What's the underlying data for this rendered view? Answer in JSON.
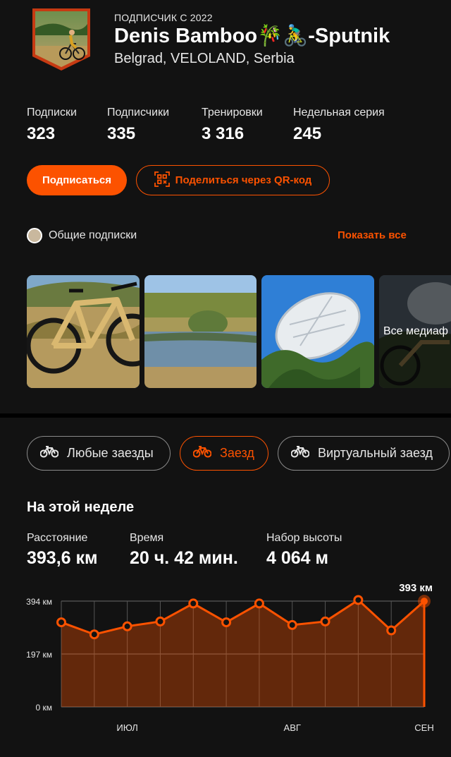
{
  "profile": {
    "since": "ПОДПИСЧИК С 2022",
    "name": "Denis Bamboo🎋🚴‍♂️-Sputnik",
    "location": "Belgrad, VELOLAND, Serbia"
  },
  "stats": [
    {
      "label": "Подписки",
      "value": "323"
    },
    {
      "label": "Подписчики",
      "value": "335"
    },
    {
      "label": "Тренировки",
      "value": "3 316"
    },
    {
      "label": "Недельная серия",
      "value": "245"
    }
  ],
  "actions": {
    "follow": "Подписаться",
    "share_qr": "Поделиться через QR-код"
  },
  "mutual": {
    "label": "Общие подписки",
    "show_all": "Показать все"
  },
  "media": {
    "all_media": "Все медиаф"
  },
  "filters": [
    {
      "label": "Любые заезды",
      "active": false,
      "icon": "bike-icon"
    },
    {
      "label": "Заезд",
      "active": true,
      "icon": "bike-icon"
    },
    {
      "label": "Виртуальный заезд",
      "active": false,
      "icon": "bike-icon"
    }
  ],
  "week": {
    "title": "На этой неделе",
    "metrics": [
      {
        "label": "Расстояние",
        "value": "393,6 км"
      },
      {
        "label": "Время",
        "value": "20 ч. 42 мин."
      },
      {
        "label": "Набор высоты",
        "value": "4 064 м"
      }
    ]
  },
  "colors": {
    "accent": "#fc5200",
    "background": "#121212"
  },
  "chart_data": {
    "type": "area",
    "y_tick_labels": [
      "394 км",
      "197 км",
      "0 км"
    ],
    "y_ticks": [
      394,
      197,
      0
    ],
    "ylim": [
      0,
      394
    ],
    "x_tick_labels": [
      "ИЮЛ",
      "АВГ",
      "СЕН"
    ],
    "x_tick_index": [
      2,
      7,
      11
    ],
    "values": [
      315,
      270,
      300,
      318,
      385,
      315,
      385,
      305,
      318,
      398,
      285,
      393.6
    ],
    "last_label": "393 км",
    "grid": true
  }
}
